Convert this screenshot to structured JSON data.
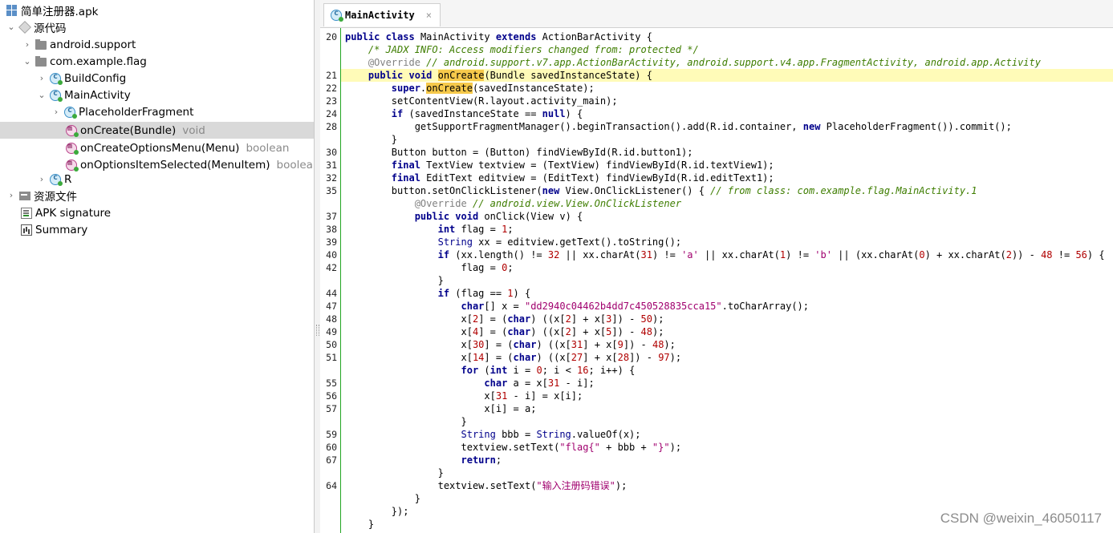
{
  "tree": {
    "items": [
      {
        "label": "简单注册器.apk",
        "type": ""
      },
      {
        "label": "源代码",
        "type": ""
      },
      {
        "label": "android.support",
        "type": ""
      },
      {
        "label": "com.example.flag",
        "type": ""
      },
      {
        "label": "BuildConfig",
        "type": ""
      },
      {
        "label": "MainActivity",
        "type": ""
      },
      {
        "label": "PlaceholderFragment",
        "type": ""
      },
      {
        "label": "onCreate(Bundle)",
        "type": "void"
      },
      {
        "label": "onCreateOptionsMenu(Menu)",
        "type": "boolean"
      },
      {
        "label": "onOptionsItemSelected(MenuItem)",
        "type": "boolea"
      },
      {
        "label": "R",
        "type": ""
      },
      {
        "label": "资源文件",
        "type": ""
      },
      {
        "label": "APK signature",
        "type": ""
      },
      {
        "label": "Summary",
        "type": ""
      }
    ]
  },
  "tab": {
    "label": "MainActivity",
    "close": "×"
  },
  "editor": {
    "lines": [
      {
        "n": "20",
        "t": "public class MainActivity extends ActionBarActivity {"
      },
      {
        "n": "",
        "t": "    /* JADX INFO: Access modifiers changed from: protected */"
      },
      {
        "n": "",
        "t": "    @Override // android.support.v7.app.ActionBarActivity, android.support.v4.app.FragmentActivity, android.app.Activity"
      },
      {
        "n": "21",
        "t": "    public void onCreate(Bundle savedInstanceState) {"
      },
      {
        "n": "22",
        "t": "        super.onCreate(savedInstanceState);"
      },
      {
        "n": "23",
        "t": "        setContentView(R.layout.activity_main);"
      },
      {
        "n": "24",
        "t": "        if (savedInstanceState == null) {"
      },
      {
        "n": "28",
        "t": "            getSupportFragmentManager().beginTransaction().add(R.id.container, new PlaceholderFragment()).commit();"
      },
      {
        "n": "",
        "t": "        }"
      },
      {
        "n": "30",
        "t": "        Button button = (Button) findViewById(R.id.button1);"
      },
      {
        "n": "31",
        "t": "        final TextView textview = (TextView) findViewById(R.id.textView1);"
      },
      {
        "n": "32",
        "t": "        final EditText editview = (EditText) findViewById(R.id.editText1);"
      },
      {
        "n": "35",
        "t": "        button.setOnClickListener(new View.OnClickListener() { // from class: com.example.flag.MainActivity.1"
      },
      {
        "n": "",
        "t": "            @Override // android.view.View.OnClickListener"
      },
      {
        "n": "37",
        "t": "            public void onClick(View v) {"
      },
      {
        "n": "38",
        "t": "                int flag = 1;"
      },
      {
        "n": "39",
        "t": "                String xx = editview.getText().toString();"
      },
      {
        "n": "40",
        "t": "                if (xx.length() != 32 || xx.charAt(31) != 'a' || xx.charAt(1) != 'b' || (xx.charAt(0) + xx.charAt(2)) - 48 != 56) {"
      },
      {
        "n": "42",
        "t": "                    flag = 0;"
      },
      {
        "n": "",
        "t": "                }"
      },
      {
        "n": "44",
        "t": "                if (flag == 1) {"
      },
      {
        "n": "47",
        "t": "                    char[] x = \"dd2940c04462b4dd7c450528835cca15\".toCharArray();"
      },
      {
        "n": "48",
        "t": "                    x[2] = (char) ((x[2] + x[3]) - 50);"
      },
      {
        "n": "49",
        "t": "                    x[4] = (char) ((x[2] + x[5]) - 48);"
      },
      {
        "n": "50",
        "t": "                    x[30] = (char) ((x[31] + x[9]) - 48);"
      },
      {
        "n": "51",
        "t": "                    x[14] = (char) ((x[27] + x[28]) - 97);"
      },
      {
        "n": "",
        "t": "                    for (int i = 0; i < 16; i++) {"
      },
      {
        "n": "55",
        "t": "                        char a = x[31 - i];"
      },
      {
        "n": "56",
        "t": "                        x[31 - i] = x[i];"
      },
      {
        "n": "57",
        "t": "                        x[i] = a;"
      },
      {
        "n": "",
        "t": "                    }"
      },
      {
        "n": "59",
        "t": "                    String bbb = String.valueOf(x);"
      },
      {
        "n": "60",
        "t": "                    textview.setText(\"flag{\" + bbb + \"}\");"
      },
      {
        "n": "67",
        "t": "                    return;"
      },
      {
        "n": "",
        "t": "                }"
      },
      {
        "n": "64",
        "t": "                textview.setText(\"输入注册码错误\");"
      },
      {
        "n": "",
        "t": "            }"
      },
      {
        "n": "",
        "t": "        });"
      },
      {
        "n": "",
        "t": "    }"
      }
    ]
  },
  "watermark": "CSDN @weixin_46050117"
}
